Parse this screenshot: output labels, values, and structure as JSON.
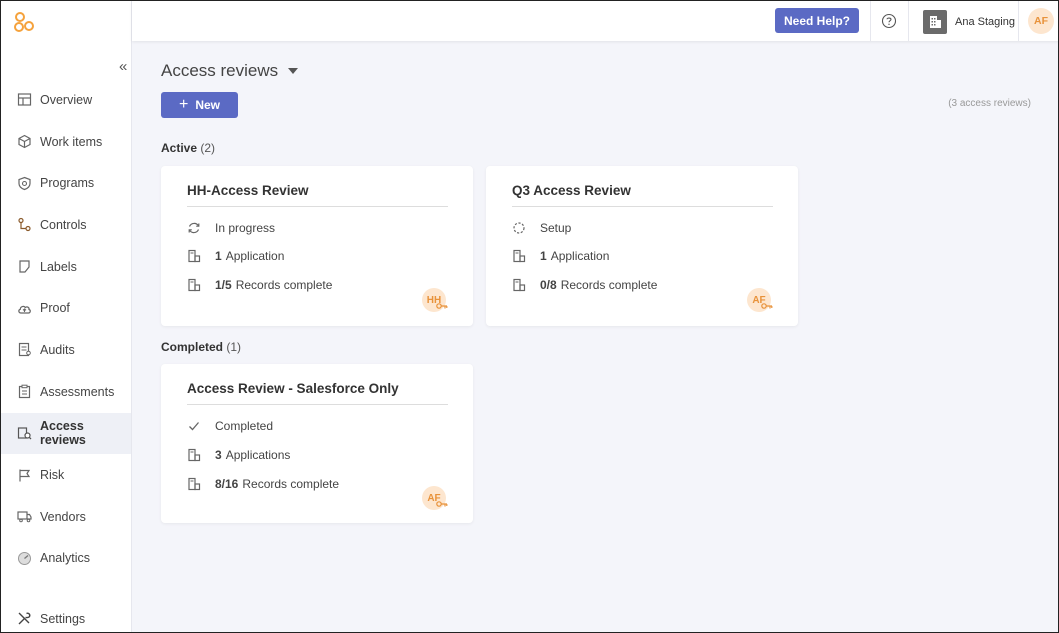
{
  "sidebar": {
    "collapse_glyph": "«",
    "items": [
      {
        "label": "Overview",
        "icon": "overview-icon"
      },
      {
        "label": "Work items",
        "icon": "box-icon"
      },
      {
        "label": "Programs",
        "icon": "shield-icon"
      },
      {
        "label": "Controls",
        "icon": "controls-icon"
      },
      {
        "label": "Labels",
        "icon": "label-icon"
      },
      {
        "label": "Proof",
        "icon": "cloud-upload-icon"
      },
      {
        "label": "Audits",
        "icon": "audit-icon"
      },
      {
        "label": "Assessments",
        "icon": "clipboard-icon"
      },
      {
        "label": "Access reviews",
        "icon": "access-review-icon",
        "active": true
      },
      {
        "label": "Risk",
        "icon": "flag-icon"
      },
      {
        "label": "Vendors",
        "icon": "truck-icon"
      },
      {
        "label": "Analytics",
        "icon": "gauge-icon"
      }
    ],
    "settings_label": "Settings"
  },
  "topbar": {
    "help_label": "Need Help?",
    "org_name": "Ana Staging",
    "user_initials": "AF"
  },
  "main": {
    "title": "Access reviews",
    "new_label": "New",
    "count_text": "(3 access reviews)",
    "active_section": {
      "label": "Active",
      "count": "(2)"
    },
    "completed_section": {
      "label": "Completed",
      "count": "(1)"
    },
    "cards": [
      {
        "title": "HH-Access Review",
        "status": "In progress",
        "status_icon": "refresh-icon",
        "apps_count": "1",
        "apps_label": "Application",
        "records_count": "1/5",
        "records_label": "Records complete",
        "owner_initials": "HH"
      },
      {
        "title": "Q3 Access Review",
        "status": "Setup",
        "status_icon": "dashed-circle-icon",
        "apps_count": "1",
        "apps_label": "Application",
        "records_count": "0/8",
        "records_label": "Records complete",
        "owner_initials": "AF"
      },
      {
        "title": "Access Review - Salesforce Only",
        "status": "Completed",
        "status_icon": "check-icon",
        "apps_count": "3",
        "apps_label": "Applications",
        "records_count": "8/16",
        "records_label": "Records complete",
        "owner_initials": "AF"
      }
    ]
  },
  "colors": {
    "accent": "#5b6ac4",
    "avatar_bg": "#fde6cf",
    "avatar_text": "#e8923a",
    "logo": "#f5a23c",
    "page_bg": "#f4f5fa"
  }
}
